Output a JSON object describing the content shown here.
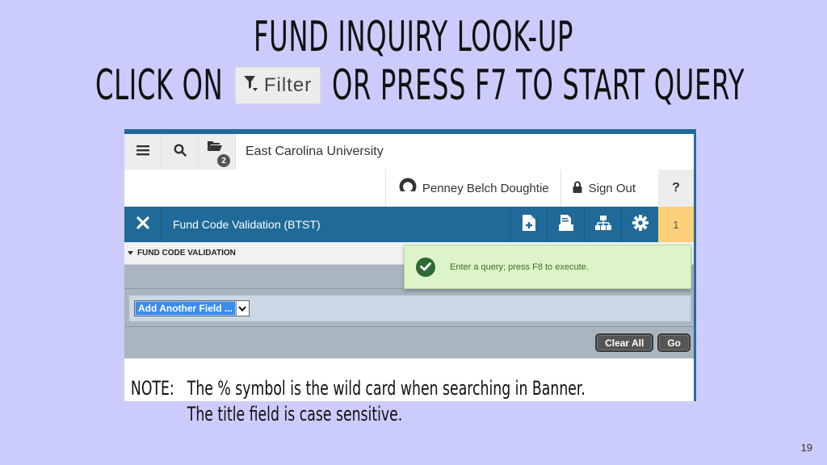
{
  "slide": {
    "title_line1": "FUND INQUIRY LOOK-UP",
    "title_line2_before": "CLICK ON",
    "filter_button_label": "Filter",
    "title_line2_after": "OR PRESS F7 TO START QUERY",
    "page_number": "19"
  },
  "app": {
    "header": {
      "menu_icon": "hamburger-menu-icon",
      "search_icon": "search-icon",
      "recent_icon": "folder-icon",
      "recent_badge": "2",
      "institution": "East Carolina University",
      "user_name": "Penney Belch Doughtie",
      "sign_out": "Sign Out",
      "help": "?"
    },
    "toolbar": {
      "close_icon": "close-icon",
      "page_title": "Fund Code Validation (BTST)",
      "tools": [
        "add-page-icon",
        "retrieve-page-icon",
        "related-icon",
        "gear-icon"
      ],
      "notification_count": "1"
    },
    "section": {
      "title": "FUND CODE VALIDATION"
    },
    "filter": {
      "add_field_value": "Add Another Field ...",
      "clear_all": "Clear All",
      "go": "Go"
    },
    "notification": {
      "message": "Enter a query; press F8 to execute."
    },
    "colors": {
      "brand_blue": "#1f6a98",
      "notification_bg": "#ddf4c8",
      "count_badge": "#fdd07a",
      "slide_bg": "#ccccfc"
    }
  },
  "note": {
    "label": "NOTE:",
    "line1": "The % symbol is the wild card when searching in Banner.",
    "line2": "The title field is case sensitive."
  }
}
